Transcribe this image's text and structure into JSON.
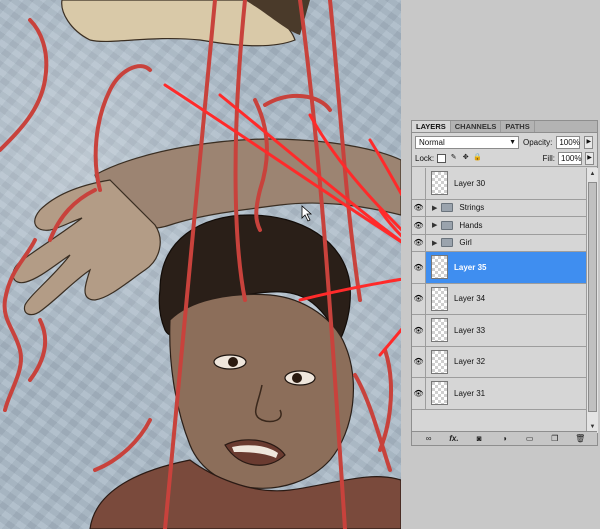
{
  "panel": {
    "tabs": [
      "LAYERS",
      "CHANNELS",
      "PATHS"
    ],
    "blend_mode": "Normal",
    "opacity_label": "Opacity:",
    "opacity_value": "100%",
    "lock_label": "Lock:",
    "fill_label": "Fill:",
    "fill_value": "100%",
    "layers": [
      {
        "name": "Layer 30",
        "type": "layer",
        "visible": false,
        "selected": false
      },
      {
        "name": "Strings",
        "type": "group",
        "visible": true,
        "selected": false
      },
      {
        "name": "Hands",
        "type": "group",
        "visible": true,
        "selected": false
      },
      {
        "name": "Girl",
        "type": "group",
        "visible": true,
        "selected": false
      },
      {
        "name": "Layer 35",
        "type": "layer",
        "visible": true,
        "selected": true
      },
      {
        "name": "Layer 34",
        "type": "layer",
        "visible": true,
        "selected": false
      },
      {
        "name": "Layer 33",
        "type": "layer",
        "visible": true,
        "selected": false
      },
      {
        "name": "Layer 32",
        "type": "layer",
        "visible": true,
        "selected": false
      },
      {
        "name": "Layer 31",
        "type": "layer",
        "visible": true,
        "selected": false
      }
    ],
    "bottom_icons": [
      "link-icon",
      "fx-icon",
      "mask-icon",
      "adjustment-icon",
      "folder-icon",
      "new-layer-icon",
      "trash-icon"
    ],
    "fx_label": "fx."
  },
  "colors": {
    "selection": "#3f8ef0",
    "annotation_red": "#ff2a2a",
    "string_red": "#c8423c"
  }
}
